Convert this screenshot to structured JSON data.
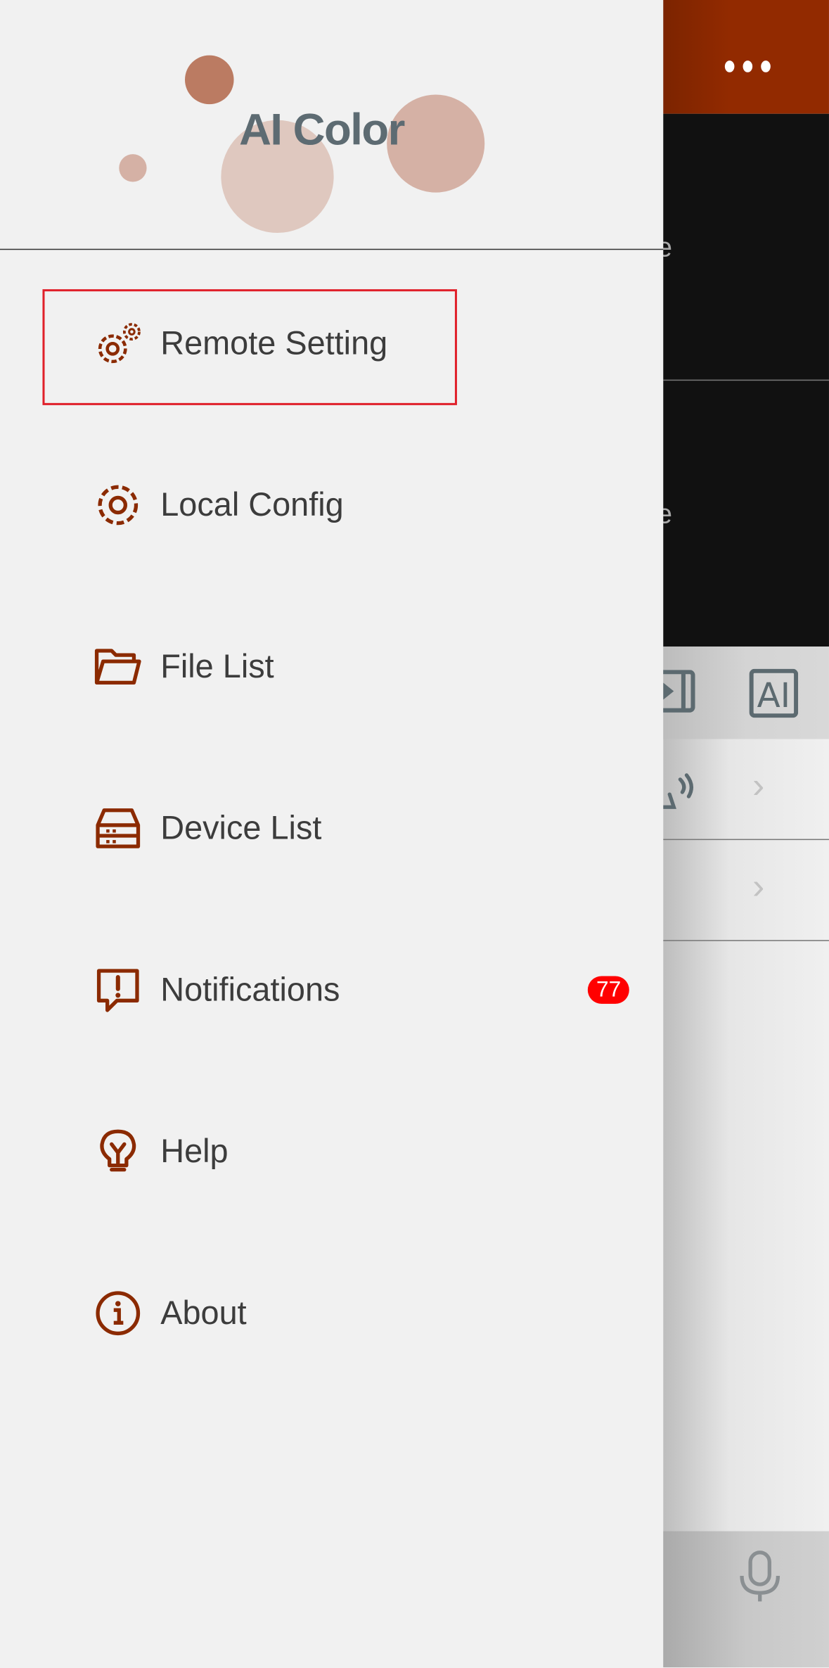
{
  "app": {
    "logo_text": "AI Color"
  },
  "menu": {
    "items": [
      {
        "label": "Remote Setting",
        "icon": "gears-icon"
      },
      {
        "label": "Local Config",
        "icon": "gear-icon"
      },
      {
        "label": "File List",
        "icon": "folder-icon"
      },
      {
        "label": "Device List",
        "icon": "device-icon"
      },
      {
        "label": "Notifications",
        "icon": "alert-message-icon",
        "badge": "77"
      },
      {
        "label": "Help",
        "icon": "lightbulb-icon"
      },
      {
        "label": "About",
        "icon": "info-icon"
      }
    ],
    "highlighted": "Remote Setting"
  },
  "background": {
    "panel1_text": "e",
    "panel2_text": "e",
    "toolbar_ai_label": "AI"
  },
  "colors": {
    "accent": "#922a00",
    "icon": "#8b2a00",
    "highlight": "#e0202a",
    "badge": "#ff0000"
  }
}
